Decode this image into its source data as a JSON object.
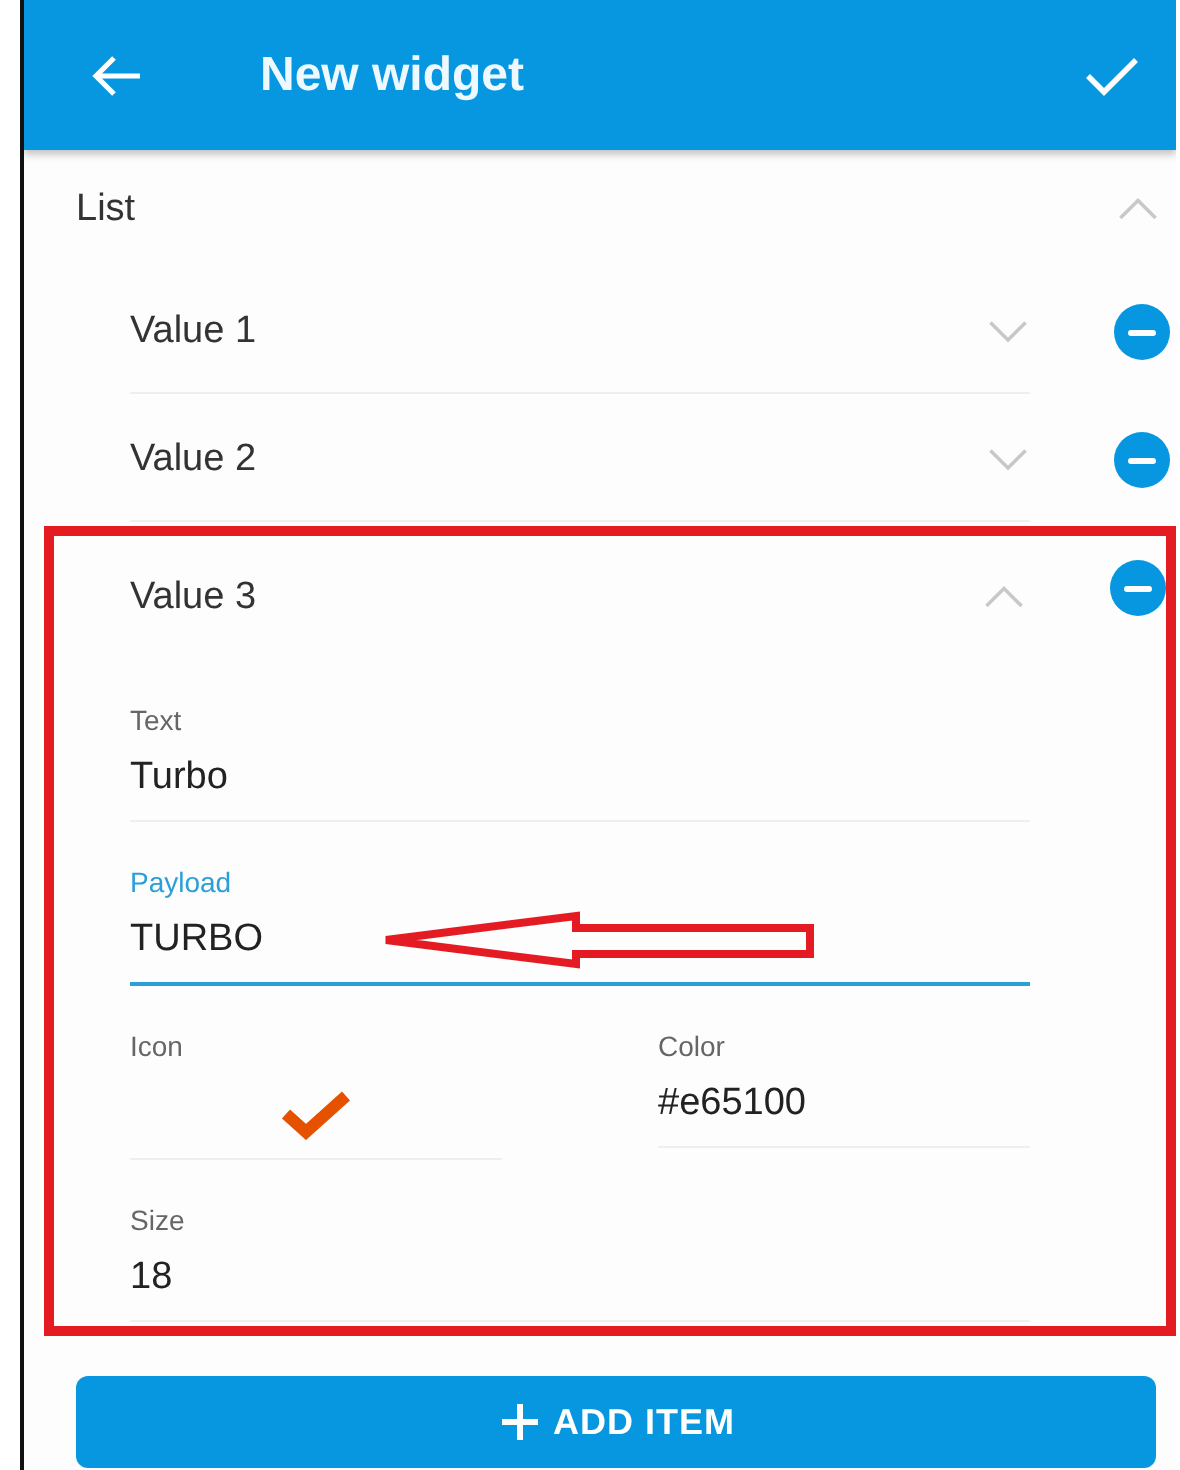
{
  "header": {
    "title": "New widget"
  },
  "list": {
    "label": "List",
    "expanded": true,
    "items": [
      {
        "label": "Value 1",
        "expanded": false,
        "highlighted": false
      },
      {
        "label": "Value 2",
        "expanded": false,
        "highlighted": false
      },
      {
        "label": "Value 3",
        "expanded": true,
        "highlighted": true,
        "field_rows": [
          {
            "fields": [
              {
                "kind": "text",
                "label": "Text",
                "value": "Turbo",
                "focused": false,
                "arrow": false
              }
            ]
          },
          {
            "fields": [
              {
                "kind": "text",
                "label": "Payload",
                "value": "TURBO",
                "focused": true,
                "arrow": true
              }
            ]
          },
          {
            "fields": [
              {
                "kind": "icon",
                "label": "Icon"
              },
              {
                "kind": "text",
                "label": "Color",
                "value": "#e65100",
                "focused": false,
                "arrow": false
              }
            ]
          },
          {
            "fields": [
              {
                "kind": "text",
                "label": "Size",
                "value": "18",
                "focused": false,
                "arrow": false
              }
            ]
          }
        ]
      }
    ]
  },
  "add_button": {
    "label": "ADD ITEM"
  }
}
